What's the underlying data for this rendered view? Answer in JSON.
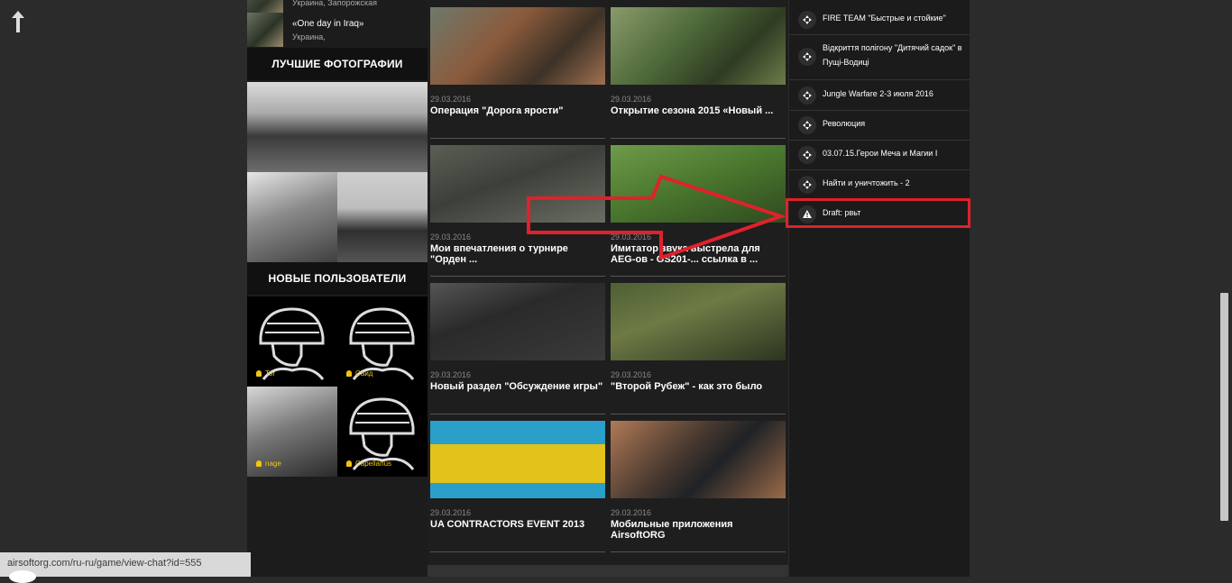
{
  "left": {
    "news": [
      {
        "title": "",
        "meta": "Украина, Запорожская"
      },
      {
        "title": "«One day in Iraq»",
        "meta": "Украина,"
      }
    ],
    "best_photos_heading": "ЛУЧШИЕ ФОТОГРАФИИ",
    "new_users_heading": "НОВЫЕ ПОЛЬЗОВАТЕЛИ",
    "users": [
      {
        "name": "Tor"
      },
      {
        "name": "Саид"
      },
      {
        "name": "nage"
      },
      {
        "name": "Capellanus"
      }
    ]
  },
  "articles": [
    {
      "date": "29.03.2016",
      "title": "Операция \"Дорога ярости\""
    },
    {
      "date": "29.03.2016",
      "title": "Открытие сезона 2015 «Новый ..."
    },
    {
      "date": "29.03.2016",
      "title": "Мои впечатления о турнире \"Орден ..."
    },
    {
      "date": "29.03.2016",
      "title": "Имитатор звука выстрела для AEG-ов - GS201-... ссылка в ..."
    },
    {
      "date": "29.03.2016",
      "title": "Новый раздел \"Обсуждение игры\""
    },
    {
      "date": "29.03.2016",
      "title": "\"Второй Рубеж\" - как это было"
    },
    {
      "date": "29.03.2016",
      "title": "UA CONTRACTORS EVENT 2013"
    },
    {
      "date": "29.03.2016",
      "title": "Мобильные приложения AirsoftORG"
    }
  ],
  "sidebar": {
    "items": [
      {
        "label": "FIRE TEAM \"Быстрые и стойкие\"",
        "icon": "diamond-arrows-icon"
      },
      {
        "label": "Відкриття полігону \"Дитячий садок\" в Пущі-Водиці",
        "icon": "diamond-arrows-icon"
      },
      {
        "label": "Jungle Warfare 2-3 июля 2016",
        "icon": "diamond-arrows-icon"
      },
      {
        "label": "Революция",
        "icon": "diamond-arrows-icon"
      },
      {
        "label": "03.07.15.Герои Меча и Магии I",
        "icon": "diamond-arrows-icon"
      },
      {
        "label": "Найти и уничтожить - 2",
        "icon": "diamond-arrows-icon"
      },
      {
        "label": "Draft: рвьт",
        "icon": "warning-icon"
      }
    ]
  },
  "status": {
    "url": "airsoftorg.com/ru-ru/game/view-chat?id=555"
  },
  "colors": {
    "highlight": "#e0212b",
    "accent": "#f1c40f"
  }
}
